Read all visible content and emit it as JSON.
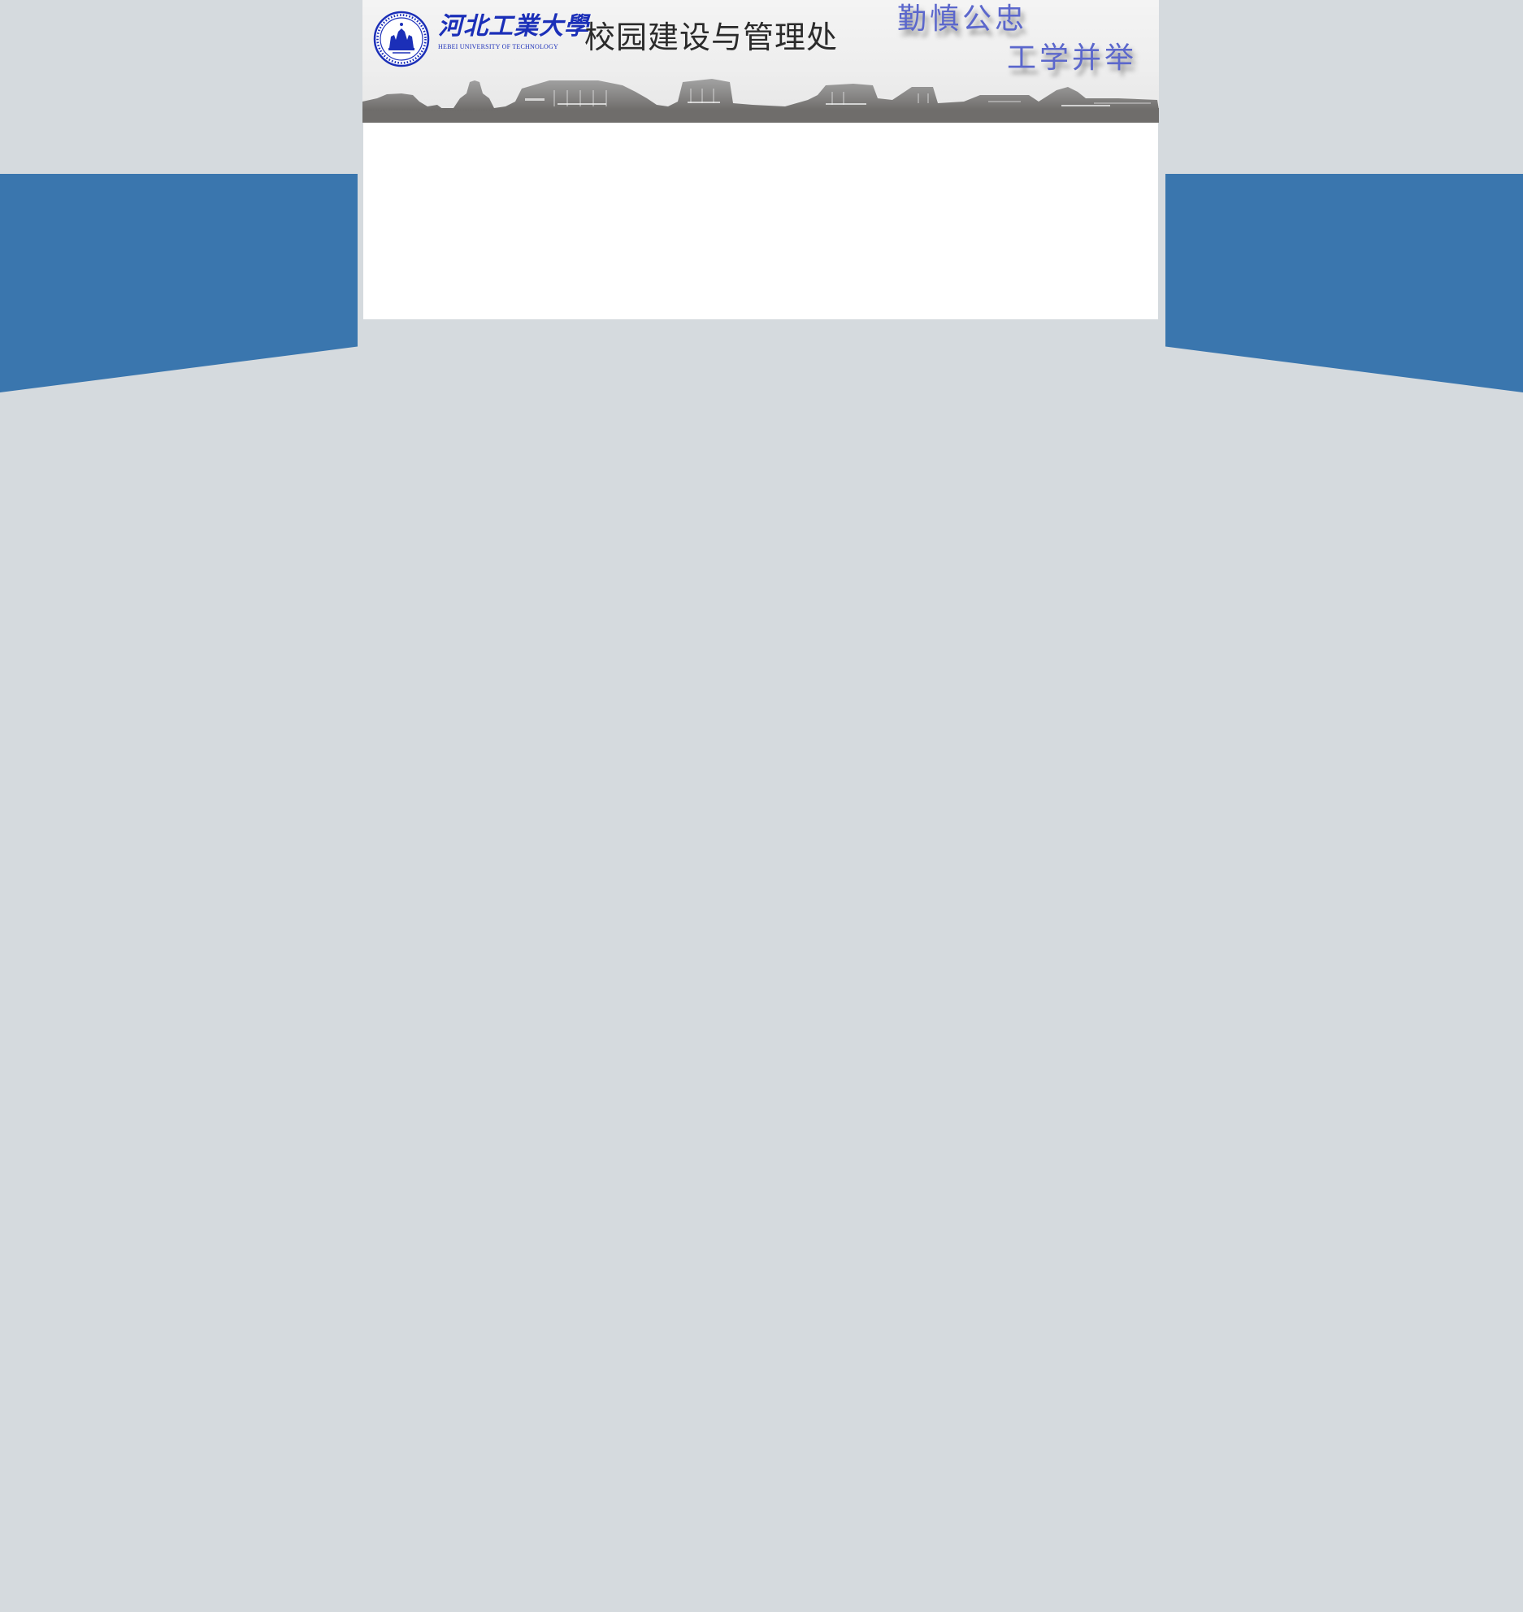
{
  "header": {
    "university_name_cn": "河北工業大學",
    "university_name_en": "HEBEI UNIVERSITY OF TECHNOLOGY",
    "department_title": "校园建设与管理处",
    "motto_line1": "勤慎公忠",
    "motto_line2": "工学并举"
  },
  "colors": {
    "page_background": "#d5dade",
    "side_band": "#3a76ae",
    "logo_blue": "#1b2fb8",
    "motto_blue": "#5b67cc",
    "content_background": "#ffffff"
  },
  "icons": {
    "logo": "university-seal-icon",
    "skyline": "campus-skyline-image"
  }
}
